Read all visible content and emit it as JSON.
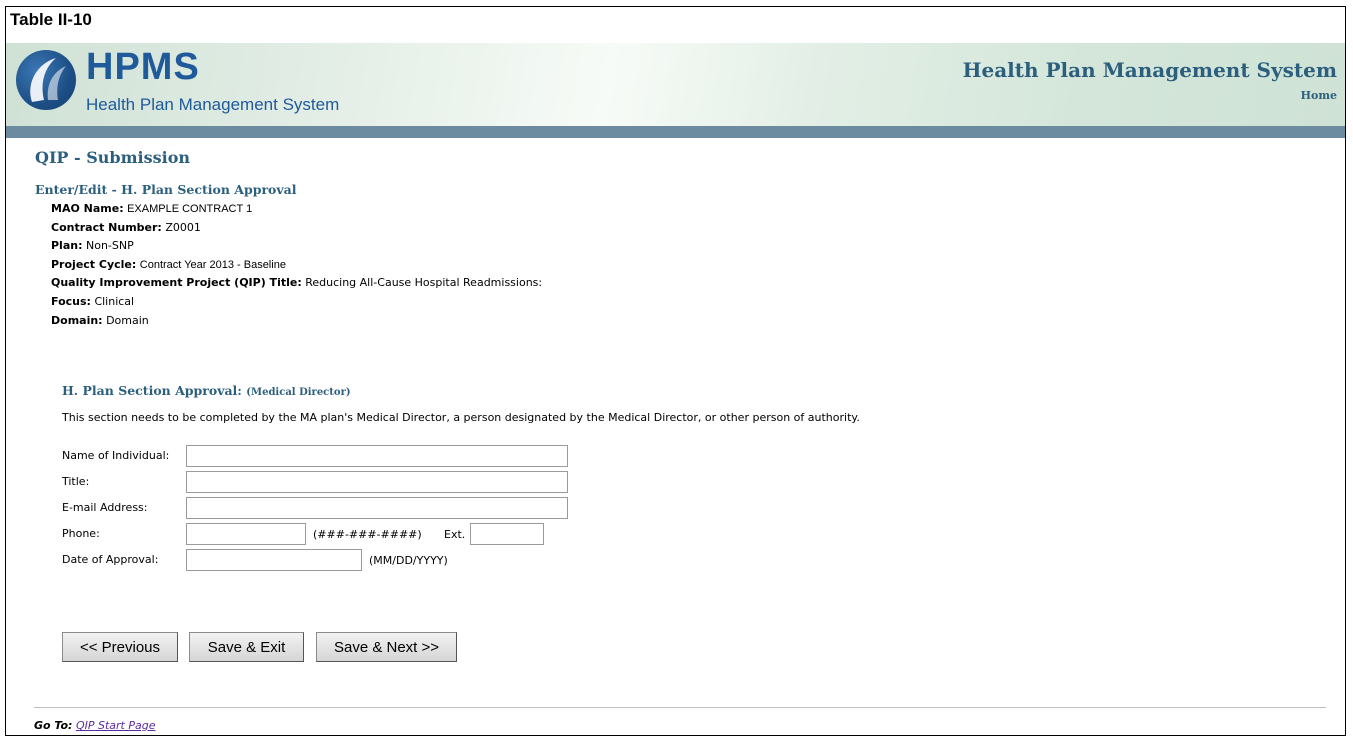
{
  "table_label": "Table II-10",
  "banner": {
    "logo_text": "HPMS",
    "logo_sub": "Health Plan Management System",
    "title": "Health Plan Management System",
    "home_link": "Home"
  },
  "page_title": "QIP - Submission",
  "sub_title": "Enter/Edit - H. Plan Section Approval",
  "info": {
    "mao_label": "MAO Name:",
    "mao_value": "EXAMPLE CONTRACT 1",
    "contract_label": "Contract Number:",
    "contract_value": "Z0001",
    "plan_label": "Plan:",
    "plan_value": "Non-SNP",
    "cycle_label": "Project Cycle:",
    "cycle_value": "Contract Year 2013 - Baseline",
    "qip_label": "Quality Improvement Project (QIP) Title:",
    "qip_value": "Reducing All-Cause Hospital Readmissions:",
    "focus_label": "Focus:",
    "focus_value": "Clinical",
    "domain_label": "Domain:",
    "domain_value": "Domain"
  },
  "section": {
    "title": "H. Plan Section Approval:",
    "title_sub": "(Medical Director)",
    "description": "This section needs to be completed by the MA plan's Medical Director, a person designated by the Medical Director, or other person of authority."
  },
  "form": {
    "name_label": "Name of Individual:",
    "name_value": "",
    "title_label": "Title:",
    "title_value": "",
    "email_label": "E-mail Address:",
    "email_value": "",
    "phone_label": "Phone:",
    "phone_value": "",
    "phone_hint": "(###-###-####)",
    "ext_label": "Ext.",
    "ext_value": "",
    "date_label": "Date of Approval:",
    "date_value": "",
    "date_hint": "(MM/DD/YYYY)"
  },
  "buttons": {
    "previous": "<< Previous",
    "save_exit": "Save & Exit",
    "save_next": "Save & Next >>"
  },
  "footer": {
    "goto_label": "Go To:",
    "goto_link": "QIP Start Page"
  }
}
